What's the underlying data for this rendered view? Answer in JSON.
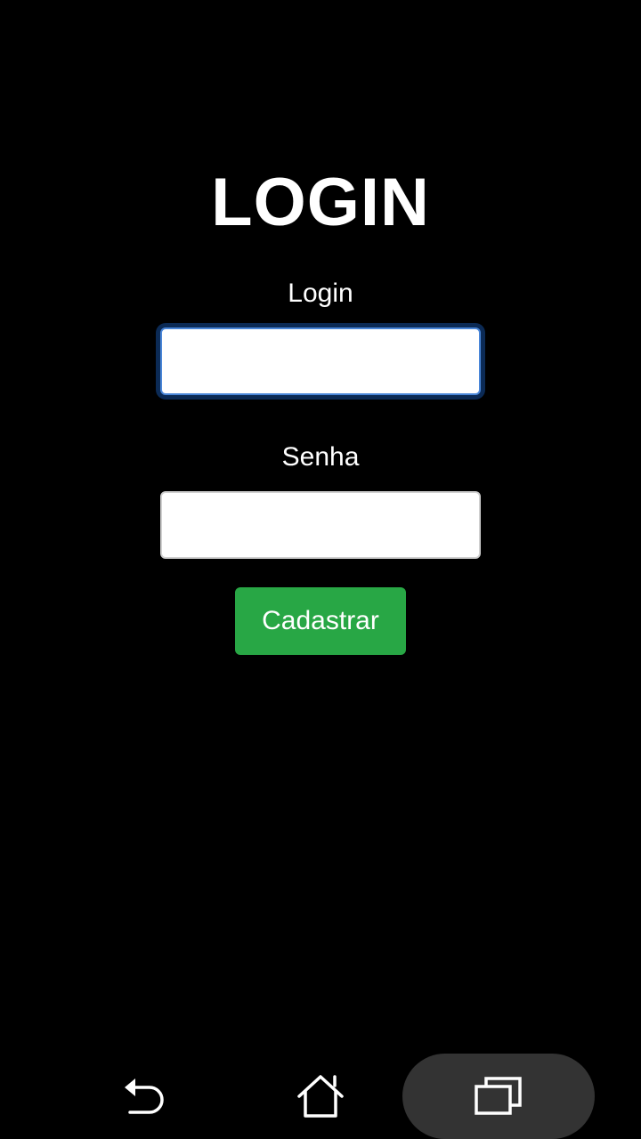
{
  "page": {
    "title": "LOGIN"
  },
  "form": {
    "login_label": "Login",
    "login_value": "",
    "senha_label": "Senha",
    "senha_value": "",
    "submit_label": "Cadastrar"
  },
  "colors": {
    "background": "#000000",
    "text": "#ffffff",
    "button_green": "#28a745",
    "focus_blue": "#4a86d8"
  },
  "navbar": {
    "back_icon": "back-icon",
    "home_icon": "home-icon",
    "recents_icon": "recents-icon"
  }
}
